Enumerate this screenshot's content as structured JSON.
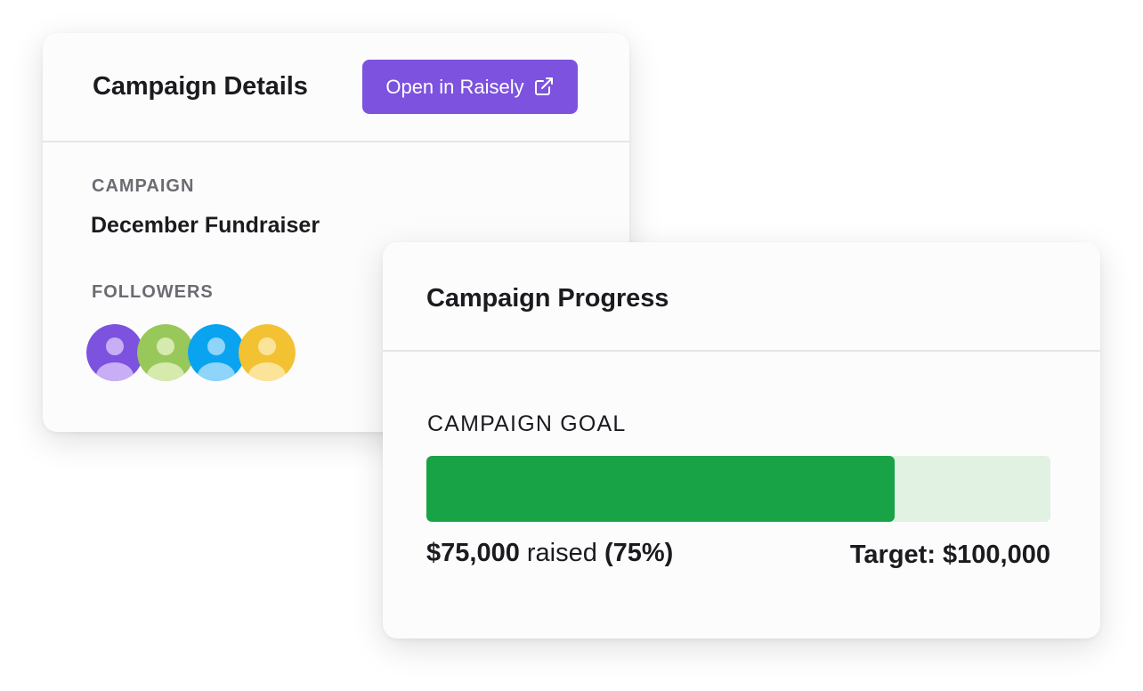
{
  "details_card": {
    "title": "Campaign Details",
    "open_button_label": "Open in Raisely",
    "open_button_icon": "external-link-icon",
    "campaign_label": "CAMPAIGN",
    "campaign_value": "December Fundraiser",
    "followers_label": "FOLLOWERS",
    "followers": [
      {
        "icon": "user-avatar-icon",
        "bg": "#7c52de",
        "fg": "#c7aef5"
      },
      {
        "icon": "user-avatar-icon",
        "bg": "#98c85a",
        "fg": "#d6eaae"
      },
      {
        "icon": "user-avatar-icon",
        "bg": "#0aa3f0",
        "fg": "#8fd4fa"
      },
      {
        "icon": "user-avatar-icon",
        "bg": "#f2c233",
        "fg": "#fbe39a"
      }
    ]
  },
  "progress_card": {
    "title": "Campaign Progress",
    "goal_label": "CAMPAIGN GOAL",
    "raised_amount": "$75,000",
    "raised_word": " raised ",
    "raised_percent": "(75%)",
    "target_text": "Target: $100,000",
    "progress_fraction": 0.75
  },
  "colors": {
    "accent": "#7c52de",
    "progress_fill": "#19a347",
    "progress_track": "#e1f1e2"
  }
}
